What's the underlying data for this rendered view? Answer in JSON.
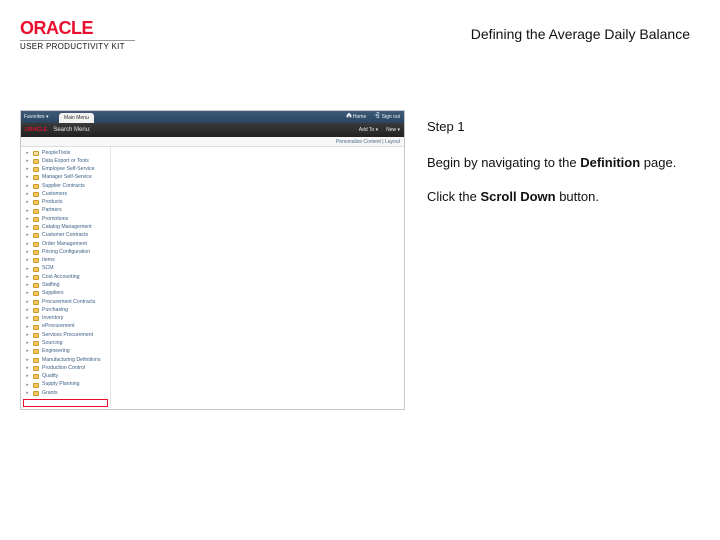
{
  "brand": {
    "logo_text": "ORACLE",
    "subtitle": "USER PRODUCTIVITY KIT"
  },
  "title": "Defining the Average Daily Balance",
  "instructions": {
    "step_label": "Step 1",
    "line1_a": "Begin by navigating to the ",
    "line1_bold": "Definition",
    "line1_b": " page.",
    "line2_a": "Click the ",
    "line2_bold": "Scroll Down",
    "line2_b": " button."
  },
  "app": {
    "top_left": "Favorites ▾",
    "active_tab": "Main Menu",
    "home": "Home",
    "signout": "Sign out",
    "brand": "ORACLE",
    "section": "Search Menu:",
    "tool1": "Add To ▾",
    "tool2": "New ▾",
    "breadcrumb": "Personalize Content | Layout"
  },
  "nav_items": [
    "PeopleTools",
    "Data Export or Tools",
    "Employee Self-Service",
    "Manager Self-Service",
    "Supplier Contracts",
    "Customers",
    "Products",
    "Partners",
    "Promotions",
    "Catalog Management",
    "Customer Contracts",
    "Order Management",
    "Pricing Configuration",
    "Items",
    "SCM",
    "Cost Accounting",
    "Staffing",
    "Suppliers",
    "Procurement Contracts",
    "Purchasing",
    "Inventory",
    "eProcurement",
    "Services Procurement",
    "Sourcing",
    "Engineering",
    "Manufacturing Definitions",
    "Production Control",
    "Quality",
    "Supply Planning",
    "Grants"
  ]
}
